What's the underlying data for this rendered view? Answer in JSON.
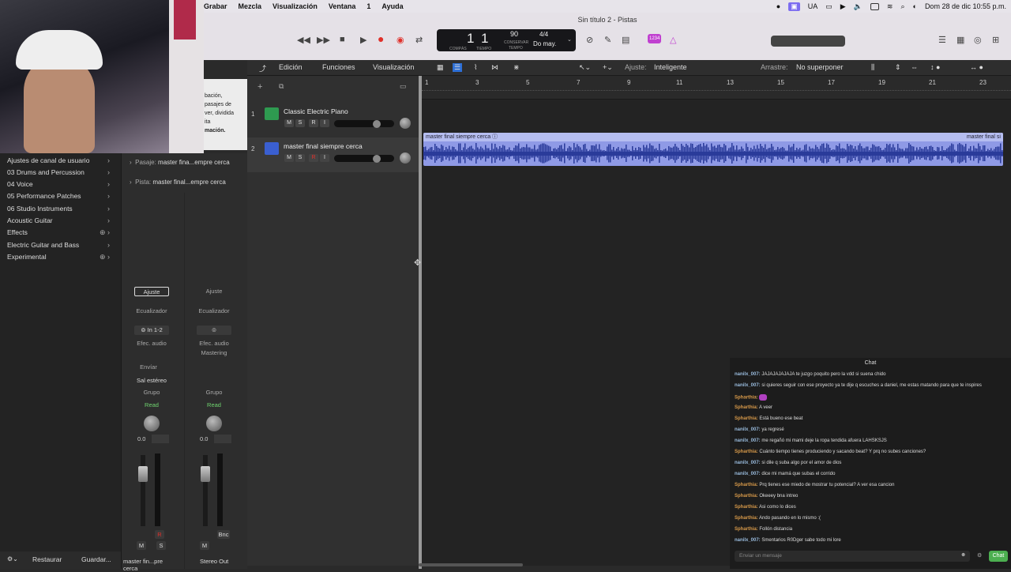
{
  "menubar": {
    "items": [
      "Grabar",
      "Mezcla",
      "Visualización",
      "Ventana",
      "1",
      "Ayuda"
    ],
    "input_indicator": "UA",
    "clock": "Dom 28 de dic  10:55 p.m."
  },
  "window": {
    "title": "Sin título 2 - Pistas"
  },
  "lcd": {
    "bar": "1",
    "beat": "1",
    "bar_label": "COMPÁS",
    "beat_label": "TIEMPO",
    "tempo": "90",
    "tempo_label": "CONSERVAR",
    "tempo_sub": "TEMPO",
    "signature": "4/4",
    "key": "Do may."
  },
  "toolbar_badge": "1234",
  "library": {
    "info_lines": [
      "bación,",
      "pasajes de",
      "ver, dividida",
      "ita",
      "mación."
    ],
    "items": [
      {
        "label": "Ajustes de canal de usuario"
      },
      {
        "label": "03 Drums and Percussion"
      },
      {
        "label": "04 Voice"
      },
      {
        "label": "05 Performance Patches"
      },
      {
        "label": "06 Studio Instruments"
      },
      {
        "label": "Acoustic Guitar"
      },
      {
        "label": "Effects"
      },
      {
        "label": "Electric Guitar and Bass"
      },
      {
        "label": "Experimental"
      }
    ],
    "restore_label": "Restaurar",
    "save_label": "Guardar..."
  },
  "inspector": {
    "region_label": "Pasaje:",
    "region_value": "master fina...empre cerca",
    "track_label": "Pista:",
    "track_value": "master final...empre cerca",
    "strip1": {
      "setting": "Ajuste",
      "eq": "Ecualizador",
      "input": "In 1-2",
      "fx": "Efec. audio",
      "sends": "Envíar",
      "output": "Sal estéreo",
      "group": "Grupo",
      "automation": "Read",
      "pan_value": "0.0",
      "mute": "M",
      "solo": "S",
      "name": "master fin...pre cerca"
    },
    "strip2": {
      "setting": "Ajuste",
      "eq": "Ecualizador",
      "fx": "Efec. audio",
      "fx_slot": "Mastering",
      "group": "Grupo",
      "automation": "Read",
      "pan_value": "0.0",
      "mute": "M",
      "bounce": "Bnc",
      "name": "Stereo Out"
    }
  },
  "tracks_toolbar": {
    "edit": "Edición",
    "functions": "Funciones",
    "view": "Visualización",
    "snap_label": "Ajuste:",
    "snap_value": "Inteligente",
    "drag_label": "Arrastre:",
    "drag_value": "No superponer"
  },
  "ruler": {
    "bars": [
      "1",
      "3",
      "5",
      "7",
      "9",
      "11",
      "13",
      "15",
      "17",
      "19",
      "21",
      "23"
    ]
  },
  "tracks": [
    {
      "number": "1",
      "name": "Classic Electric Piano",
      "m": "M",
      "s": "S",
      "r": "R",
      "i": "I"
    },
    {
      "number": "2",
      "name": "master final siempre cerca",
      "m": "M",
      "s": "S",
      "r": "R",
      "i": "I"
    }
  ],
  "region": {
    "name": "master final siempre cerca",
    "name_end": "master final si"
  },
  "chat": {
    "title": "Chat",
    "messages": [
      {
        "user": "nanilx_007:",
        "text": "JAJAJAJAJAJA te juzgo poquito pero la vdd si suena chido"
      },
      {
        "user": "nanilx_007:",
        "text": "si quieres seguir con ese proyecto ya te dije q escuches a daniel, me estas matando para que te inspires"
      },
      {
        "user": "Spharthia:",
        "text": ""
      },
      {
        "user": "Spharthia:",
        "text": "A veer"
      },
      {
        "user": "Spharthia:",
        "text": "Está bueno ese beat"
      },
      {
        "user": "nanilx_007:",
        "text": "ya regresé"
      },
      {
        "user": "nanilx_007:",
        "text": "me regañó mi mami deje la ropa tendida afuera LAHSKSJS"
      },
      {
        "user": "Spharthia:",
        "text": "Cuánto tiempo tienes produciendo y sacando beat? Y prq no subes canciones?"
      },
      {
        "user": "nanilx_007:",
        "text": "si dile q suba algo por el amor de dios"
      },
      {
        "user": "nanilx_007:",
        "text": "dice mi mamá que subas el corrido"
      },
      {
        "user": "Spharthia:",
        "text": "Prq tienes ese miedo de mostrar tu potencial? A ver esa cancion"
      },
      {
        "user": "Spharthia:",
        "text": "Okeeey bna intreo"
      },
      {
        "user": "Spharthia:",
        "text": "Asi como lo dices"
      },
      {
        "user": "Spharthia:",
        "text": "Ando pasando en lo mismo :("
      },
      {
        "user": "Spharthia:",
        "text": "Follón distancia"
      },
      {
        "user": "nanilx_007:",
        "text": "Smentarios R0Dger sabe todo mi lore"
      }
    ],
    "input_placeholder": "Enviar un mensaje",
    "send_label": "Chat"
  },
  "colors": {
    "region_fill": "#8f9ae6",
    "record": "#e0302a",
    "automation_read": "#6fd36f",
    "chat_button": "#4caf50",
    "badge": "#c040d0"
  }
}
